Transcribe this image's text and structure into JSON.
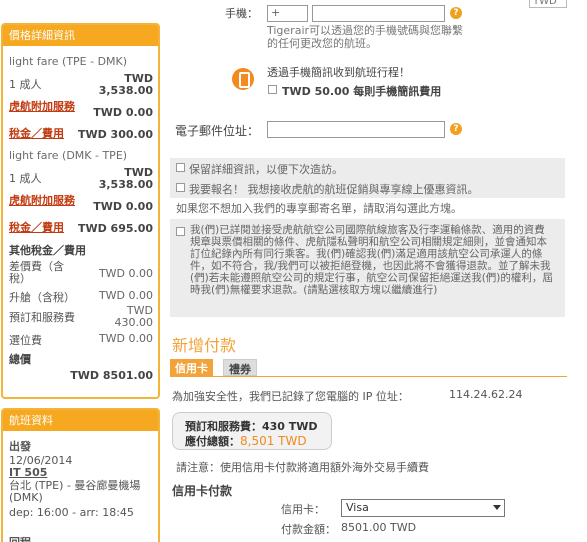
{
  "price_box": {
    "title": "價格詳細資訊",
    "segments": [
      {
        "fare": "light fare (TPE - DMK)",
        "adult_label": "1 成人",
        "adult_value": "TWD\n3,538.00",
        "addon_label": "虎航附加服務",
        "addon_value": "TWD 0.00",
        "tax_label": "稅金／費用",
        "tax_value": "TWD 300.00"
      },
      {
        "fare": "light fare (DMK - TPE)",
        "adult_label": "1 成人",
        "adult_value": "TWD\n3,538.00",
        "addon_label": "虎航附加服務",
        "addon_value": "TWD 0.00",
        "tax_label": "稅金／費用",
        "tax_value": "TWD 695.00"
      }
    ],
    "other_fees_title": "其他稅金／費用",
    "other_fees": [
      {
        "label": "差價費（含稅）",
        "value": "TWD 0.00"
      },
      {
        "label": "升艙（含稅）",
        "value": "TWD 0.00"
      },
      {
        "label": "預訂和服務費",
        "value": "TWD\n430.00"
      },
      {
        "label": "選位費",
        "value": "TWD 0.00"
      }
    ],
    "total_label": "總價",
    "total_value": "TWD 8501.00"
  },
  "flight_box": {
    "title": "航班資料",
    "depart_label": "出發",
    "date": "12/06/2014",
    "flight_no": "IT 505",
    "route": "台北 (TPE) - 曼谷廊曼機場 (DMK)",
    "times": "dep: 16:00 - arr: 18:45",
    "return_label": "回程"
  },
  "form": {
    "currency_fragment": "TWD",
    "phone_label": "手機：",
    "phone_prefix": "+",
    "phone_note": "Tigerair可以透過您的手機號碼與您聯繫的任何更改您的航班。",
    "sms_title": "透過手機簡訊收到航班行程！",
    "sms_option": "TWD 50.00 每則手機簡訊費用",
    "email_label": "電子郵件位址：",
    "save_info": "保留詳細資訊，以便下次造訪。",
    "signup": "我要報名！ 我想接收虎航的航班促銷與專享線上優惠資訊。",
    "unsubscribe": "如果您不想加入我們的專享郵寄名單，請取消勾選此方塊。",
    "terms": "我(們)已詳閱並接受虎航航空公司國際航線旅客及行李運輸條款、適用的資費規章與票價相關的條件、虎航隱私聲明和航空公司相關規定細則，並會通知本訂位紀錄內所有同行乘客。我(們)確認我(們)滿足適用該航空公司承運人的條件，如不符合，我/我們可以被拒絕登機，也因此將不會獲得退款。並了解未我(們)若未能遵照航空公司的規定行事，航空公司保留拒絕運送我(們)的權利，屆時我(們)無權要求退款。(請點選核取方塊以繼續進行)",
    "new_payment_title": "新增付款",
    "tab_credit": "信用卡",
    "tab_voucher": "禮券",
    "ip_text": "為加強安全性，我們已記錄了您電腦的 IP 位址：",
    "ip_value": "114.24.62.24",
    "fee_line": "預訂和服務費：430 TWD",
    "due_label": "應付總額：",
    "due_value": "8,501 TWD",
    "card_note": "請注意：使用信用卡付款將適用額外海外交易手續費",
    "card_pay_title": "信用卡付款",
    "card_label": "信用卡：",
    "card_value": "Visa",
    "amount_label": "付款金額：",
    "amount_value": "8501.00 TWD"
  },
  "colors": {
    "accent": "#f6a821",
    "link": "#c23a10",
    "amount_highlight": "#f08a1d"
  }
}
